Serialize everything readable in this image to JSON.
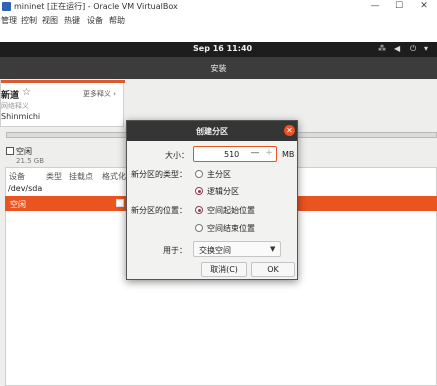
{
  "vbox": {
    "title": "mininet [正在运行] - Oracle VM VirtualBox",
    "menu": [
      "管理",
      "控制",
      "视图",
      "热键",
      "设备",
      "帮助"
    ]
  },
  "topbar": {
    "clock": "Sep 16  11:40"
  },
  "installer": {
    "title": "安装"
  },
  "dictionary": {
    "word": "新道",
    "more": "更多释义 ›",
    "sub": "网络释义",
    "name": "Shinmichi"
  },
  "disk": {
    "free_label": "空闲",
    "free_size": "21.5 GB",
    "columns": [
      "设备",
      "类型",
      "挂载点",
      "格式化"
    ],
    "device": "/dev/sda",
    "selected_row": "空闲"
  },
  "dialog": {
    "title": "创建分区",
    "size_label": "大小：",
    "size_value": "510",
    "size_unit": "MB",
    "type_label": "新分区的类型：",
    "type_options": [
      "主分区",
      "逻辑分区"
    ],
    "type_selected": "逻辑分区",
    "location_label": "新分区的位置：",
    "location_options": [
      "空间起始位置",
      "空间结束位置"
    ],
    "location_selected": "空间起始位置",
    "use_label": "用于：",
    "use_value": "交换空间",
    "cancel": "取消(C)",
    "ok": "OK"
  },
  "colors": {
    "accent": "#e95420",
    "header": "#353535",
    "radio": "#8c3b5a"
  }
}
